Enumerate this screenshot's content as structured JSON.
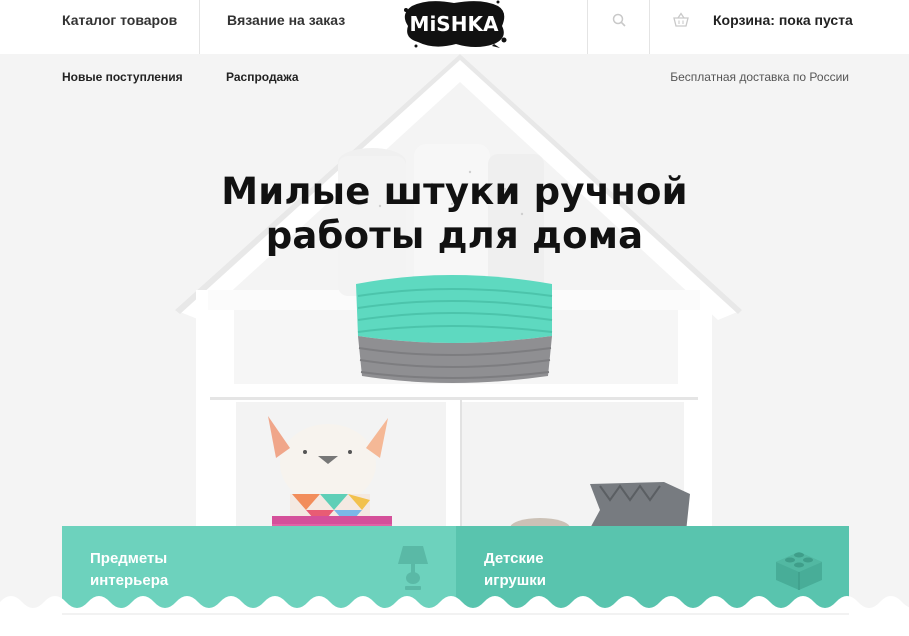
{
  "header": {
    "catalog_label": "Каталог товаров",
    "order_label": "Вязание на заказ",
    "logo_text": "MiSHKA",
    "search_icon": "search-icon",
    "cart_icon": "basket-icon",
    "cart_label": "Корзина: пока пуста"
  },
  "subnav": {
    "new_label": "Новые поступления",
    "sale_label": "Распродажа",
    "delivery_text": "Бесплатная доставка по России"
  },
  "hero": {
    "title_line1": "Милые штуки ручной",
    "title_line2": "работы для дома"
  },
  "categories": [
    {
      "label_line1": "Предметы",
      "label_line2": "интерьера",
      "icon": "lamp-icon",
      "color": "#6dd2bd"
    },
    {
      "label_line1": "Детские",
      "label_line2": "игрушки",
      "icon": "lego-brick-icon",
      "color": "#59c4ae"
    }
  ],
  "colors": {
    "accent": "#6dd2bd",
    "accent_dark": "#59c4ae",
    "header_bg": "#ffffff",
    "hero_bg": "#f4f4f4"
  }
}
